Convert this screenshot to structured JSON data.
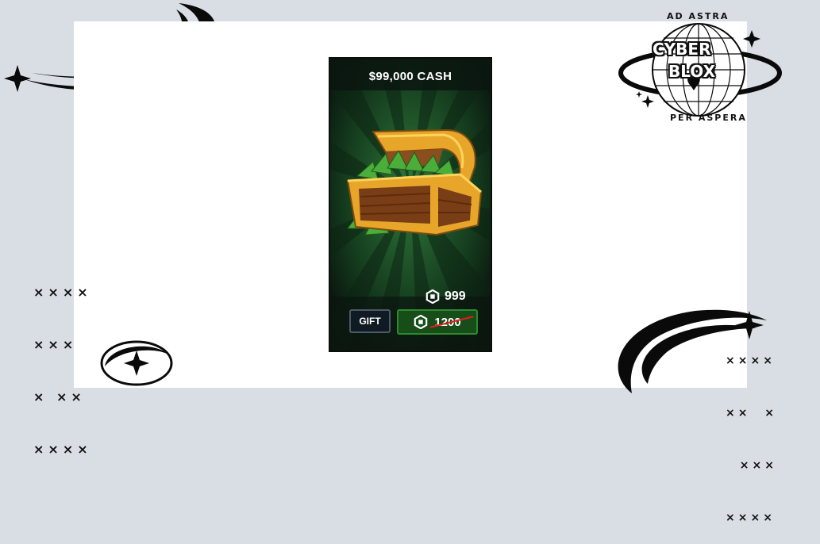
{
  "product": {
    "title": "$99,000 CASH",
    "price": "999",
    "original_price": "1200",
    "gift_label": "GIFT",
    "currency_icon": "robux-icon",
    "colors": {
      "background": "#0d1a12",
      "buy_button": "#164d19",
      "strike": "#e11d1d"
    }
  },
  "logo": {
    "top_text": "AD ASTRA",
    "word1": "CYBER",
    "word2": "BLOX",
    "bottom_text": "PER ASPERA"
  },
  "decorations": {
    "x_pattern_left": [
      "××××",
      "×××",
      "× ××",
      "××××"
    ],
    "x_pattern_right": [
      "××××",
      "××  ×",
      "  ×××",
      "××××"
    ]
  }
}
